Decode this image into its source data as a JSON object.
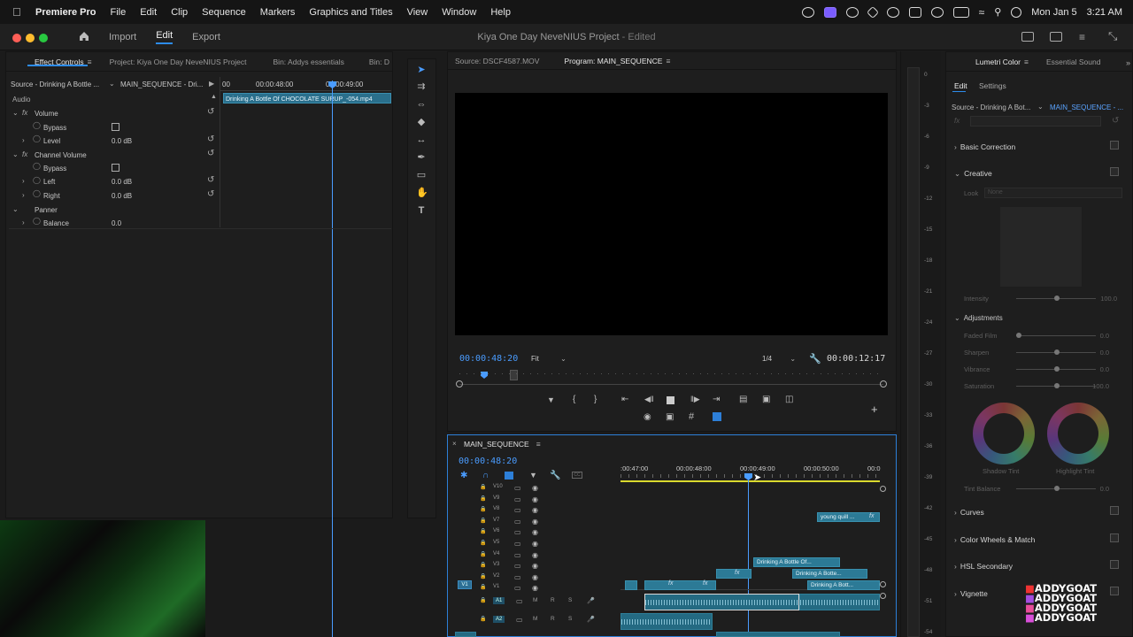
{
  "menubar": {
    "app": "Premiere Pro",
    "items": [
      "File",
      "Edit",
      "Clip",
      "Sequence",
      "Markers",
      "Graphics and Titles",
      "View",
      "Window",
      "Help"
    ],
    "date": "Mon Jan 5",
    "time": "3:21 AM"
  },
  "titlebar": {
    "tabs": [
      "Import",
      "Edit",
      "Export"
    ],
    "project_title": "Kiya One Day NeveNIUS Project",
    "status": "- Edited"
  },
  "effect_controls": {
    "tabs": [
      "Effect Controls",
      "Project: Kiya One Day NeveNIUS Project",
      "Bin: Addys essentials",
      "Bin: D"
    ],
    "source": "Source - Drinking A Bottle ...",
    "sequence": "MAIN_SEQUENCE - Dri...",
    "ruler": [
      "00",
      "00:00:48:00",
      "00:00:49:00"
    ],
    "clip_name": "Drinking A Bottle Of CHOCOLATE SURUP_-054.mp4",
    "section": "Audio",
    "rows": [
      {
        "label": "Volume",
        "value": ""
      },
      {
        "label": "Bypass",
        "value": ""
      },
      {
        "label": "Level",
        "value": "0.0 dB"
      },
      {
        "label": "Channel Volume",
        "value": ""
      },
      {
        "label": "Bypass",
        "value": ""
      },
      {
        "label": "Left",
        "value": "0.0 dB"
      },
      {
        "label": "Right",
        "value": "0.0 dB"
      },
      {
        "label": "Panner",
        "value": ""
      },
      {
        "label": "Balance",
        "value": "0.0"
      }
    ]
  },
  "program_monitor": {
    "tabs": [
      "Source: DSCF4587.MOV",
      "Program: MAIN_SEQUENCE"
    ],
    "timecode": "00:00:48:20",
    "fit": "Fit",
    "resolution": "1/4",
    "duration": "00:00:12:17"
  },
  "timeline": {
    "name": "MAIN_SEQUENCE",
    "timecode": "00:00:48:20",
    "ruler": [
      ":00:47:00",
      "00:00:48:00",
      "00:00:49:00",
      "00:00:50:00",
      "00:0"
    ],
    "video_tracks": [
      "V10",
      "V9",
      "V8",
      "V7",
      "V6",
      "V5",
      "V4",
      "V3",
      "V2",
      "V1"
    ],
    "audio_tracks": [
      "A1",
      "A2"
    ],
    "source_patch": "V1",
    "audio_buttons": [
      "M",
      "R",
      "S"
    ],
    "clips": [
      {
        "label": "young quill ...",
        "track": "V7"
      },
      {
        "label": "Drinking A Bottle Of...",
        "track": "V3"
      },
      {
        "label": "Drinking A Botte...",
        "track": "V2"
      },
      {
        "label": "Drinking A Bott...",
        "track": "V1"
      }
    ],
    "fx": "fx"
  },
  "meters": {
    "ticks": [
      "0",
      "-3",
      "-6",
      "-9",
      "-12",
      "-15",
      "-18",
      "-21",
      "-24",
      "-27",
      "-30",
      "-33",
      "-36",
      "-39",
      "-42",
      "-45",
      "-48",
      "-51",
      "-54"
    ]
  },
  "lumetri": {
    "tabs": [
      "Lumetri Color",
      "Essential Sound"
    ],
    "subtabs": [
      "Edit",
      "Settings"
    ],
    "source": "Source - Drinking A Bot...",
    "sequence": "MAIN_SEQUENCE - ...",
    "sections": [
      "Basic Correction",
      "Creative",
      "Curves",
      "Color Wheels & Match",
      "HSL Secondary",
      "Vignette"
    ],
    "look_label": "Look",
    "look_value": "None",
    "intensity": {
      "label": "Intensity",
      "value": "100.0"
    },
    "adjustments": "Adjustments",
    "sliders": [
      {
        "label": "Faded Film",
        "value": "0.0"
      },
      {
        "label": "Sharpen",
        "value": "0.0"
      },
      {
        "label": "Vibrance",
        "value": "0.0"
      },
      {
        "label": "Saturation",
        "value": "100.0"
      }
    ],
    "wheels": [
      "Shadow Tint",
      "Highlight Tint"
    ],
    "tint_balance": {
      "label": "Tint Balance",
      "value": "0.0"
    }
  },
  "watermark": [
    "ADDYGOAT",
    "ADDYGOAT",
    "ADDYGOAT",
    "ADDYGOAT"
  ]
}
